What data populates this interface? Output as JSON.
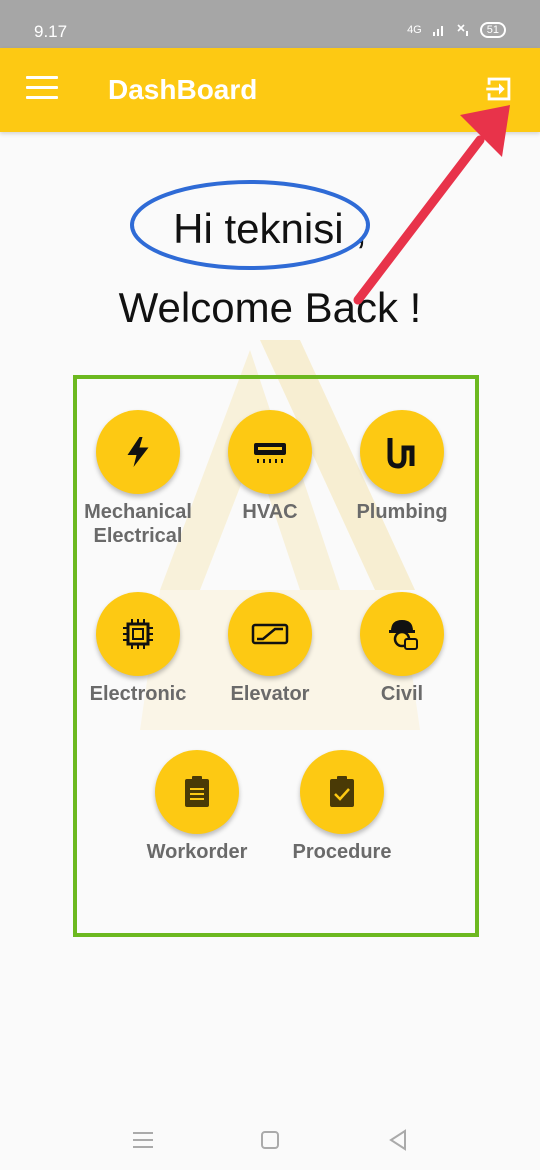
{
  "status_bar": {
    "time": "9.17",
    "network": "4G",
    "battery": "51"
  },
  "app_bar": {
    "title": "DashBoard",
    "menu_icon": "hamburger-menu-icon",
    "logout_icon": "logout-icon"
  },
  "greeting": {
    "line1": "Hi teknisi ,",
    "line2": "Welcome Back !"
  },
  "menu": {
    "items": [
      {
        "label_line1": "Mechanical",
        "label_line2": "Electrical",
        "icon": "lightning-bolt-icon"
      },
      {
        "label_line1": "HVAC",
        "label_line2": "",
        "icon": "air-conditioner-icon"
      },
      {
        "label_line1": "Plumbing",
        "label_line2": "",
        "icon": "pipe-icon"
      },
      {
        "label_line1": "Electronic",
        "label_line2": "",
        "icon": "chip-icon"
      },
      {
        "label_line1": "Elevator",
        "label_line2": "",
        "icon": "escalator-icon"
      },
      {
        "label_line1": "Civil",
        "label_line2": "",
        "icon": "construction-worker-icon"
      },
      {
        "label_line1": "Workorder",
        "label_line2": "",
        "icon": "clipboard-list-icon"
      },
      {
        "label_line1": "Procedure",
        "label_line2": "",
        "icon": "clipboard-check-icon"
      }
    ]
  },
  "colors": {
    "primary": "#fdc913",
    "icon": "#4a3a06",
    "label": "#6a6a6a",
    "highlight_box": "#6cb81f",
    "annotation_ellipse": "#2f6bd6",
    "annotation_arrow": "#e8334a"
  },
  "nav_bar": {
    "recents_icon": "recents-icon",
    "home_icon": "home-icon",
    "back_icon": "back-icon"
  }
}
